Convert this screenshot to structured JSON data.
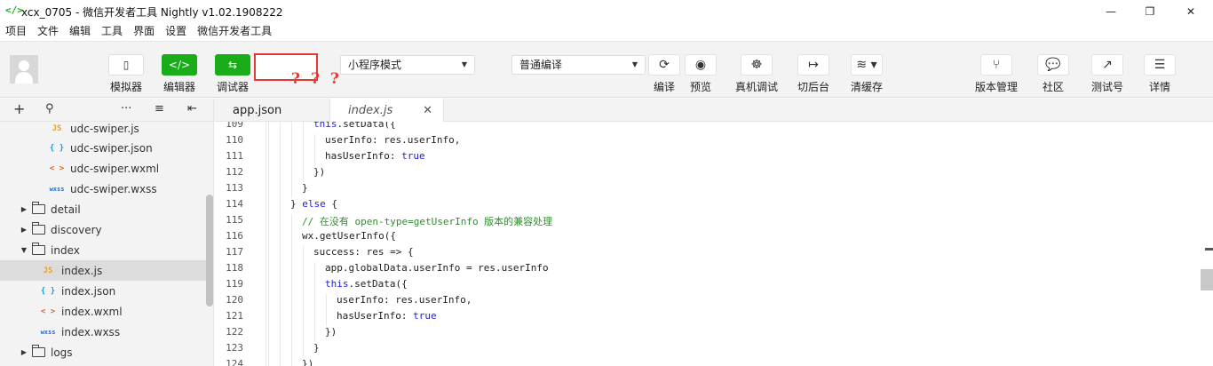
{
  "window": {
    "icon": "</>",
    "title": "xcx_0705 - 微信开发者工具 Nightly v1.02.1908222",
    "controls": [
      "—",
      "❐",
      "✕"
    ]
  },
  "menu": [
    "项目",
    "文件",
    "编辑",
    "工具",
    "界面",
    "设置",
    "微信开发者工具"
  ],
  "toolbar": {
    "left_buttons": [
      {
        "label": "模拟器",
        "icon": "phone-icon",
        "glyph": "▯"
      },
      {
        "label": "编辑器",
        "icon": "code-icon",
        "glyph": "</>"
      },
      {
        "label": "调试器",
        "icon": "debug-icon",
        "glyph": "⇆"
      }
    ],
    "annotation_marks": "???",
    "mode_select": "小程序模式",
    "compile_select": "普通编译",
    "center_buttons": [
      {
        "label": "编译",
        "icon": "refresh-icon",
        "glyph": "⟳"
      },
      {
        "label": "预览",
        "icon": "eye-icon",
        "glyph": "◉"
      },
      {
        "label": "真机调试",
        "icon": "bug-icon",
        "glyph": "☸"
      },
      {
        "label": "切后台",
        "icon": "switch-background-icon",
        "glyph": "↦"
      },
      {
        "label": "清缓存",
        "icon": "layers-icon",
        "glyph": "≋ ▾"
      }
    ],
    "right_buttons": [
      {
        "label": "版本管理",
        "icon": "branch-icon",
        "glyph": "⑂"
      },
      {
        "label": "社区",
        "icon": "chat-icon",
        "glyph": "💬"
      },
      {
        "label": "测试号",
        "icon": "external-link-icon",
        "glyph": "↗"
      },
      {
        "label": "详情",
        "icon": "menu-icon",
        "glyph": "☰"
      }
    ]
  },
  "sidebar": {
    "tools": [
      "+",
      "⚲",
      "···",
      "≡",
      "⇤"
    ],
    "items": [
      {
        "type": "js",
        "badge": "JS",
        "label": "udc-swiper.js"
      },
      {
        "type": "json",
        "badge": "{ }",
        "label": "udc-swiper.json"
      },
      {
        "type": "wxml",
        "badge": "< >",
        "label": "udc-swiper.wxml"
      },
      {
        "type": "wxss",
        "badge": "wxss",
        "label": "udc-swiper.wxss"
      },
      {
        "type": "folder",
        "expanded": false,
        "label": "detail"
      },
      {
        "type": "folder",
        "expanded": false,
        "label": "discovery"
      },
      {
        "type": "folder",
        "expanded": true,
        "label": "index"
      },
      {
        "type": "js",
        "badge": "JS",
        "label": "index.js",
        "selected": true
      },
      {
        "type": "json",
        "badge": "{ }",
        "label": "index.json"
      },
      {
        "type": "wxml",
        "badge": "< >",
        "label": "index.wxml"
      },
      {
        "type": "wxss",
        "badge": "wxss",
        "label": "index.wxss"
      },
      {
        "type": "folder",
        "expanded": false,
        "label": "logs"
      }
    ]
  },
  "editor": {
    "tabs": [
      {
        "label": "app.json",
        "active": false
      },
      {
        "label": "index.js",
        "active": true,
        "close": "✕"
      }
    ],
    "lines": [
      {
        "n": "109",
        "indent": 2,
        "parts": [
          [
            "kw",
            "this"
          ],
          [
            "",
            ".setData({"
          ]
        ]
      },
      {
        "n": "110",
        "indent": 3,
        "parts": [
          [
            "",
            "userInfo: res.userInfo,"
          ]
        ]
      },
      {
        "n": "111",
        "indent": 3,
        "parts": [
          [
            "",
            "hasUserInfo: "
          ],
          [
            "kw",
            "true"
          ]
        ]
      },
      {
        "n": "112",
        "indent": 2,
        "parts": [
          [
            "",
            "})"
          ]
        ]
      },
      {
        "n": "113",
        "indent": 1,
        "parts": [
          [
            "",
            "}"
          ]
        ]
      },
      {
        "n": "114",
        "indent": 0,
        "parts": [
          [
            "",
            "} "
          ],
          [
            "kw",
            "else"
          ],
          [
            "",
            " {"
          ]
        ]
      },
      {
        "n": "115",
        "indent": 1,
        "parts": [
          [
            "cm",
            "// 在没有 open-type=getUserInfo 版本的兼容处理"
          ]
        ]
      },
      {
        "n": "116",
        "indent": 1,
        "parts": [
          [
            "",
            "wx.getUserInfo({"
          ]
        ]
      },
      {
        "n": "117",
        "indent": 2,
        "parts": [
          [
            "",
            "success: res => {"
          ]
        ]
      },
      {
        "n": "118",
        "indent": 3,
        "parts": [
          [
            "",
            "app.globalData.userInfo = res.userInfo"
          ]
        ]
      },
      {
        "n": "119",
        "indent": 3,
        "parts": [
          [
            "kw",
            "this"
          ],
          [
            "",
            ".setData({"
          ]
        ]
      },
      {
        "n": "120",
        "indent": 4,
        "parts": [
          [
            "",
            "userInfo: res.userInfo,"
          ]
        ]
      },
      {
        "n": "121",
        "indent": 4,
        "parts": [
          [
            "",
            "hasUserInfo: "
          ],
          [
            "kw",
            "true"
          ]
        ]
      },
      {
        "n": "122",
        "indent": 3,
        "parts": [
          [
            "",
            "})"
          ]
        ]
      },
      {
        "n": "123",
        "indent": 2,
        "parts": [
          [
            "",
            "}"
          ]
        ]
      },
      {
        "n": "124",
        "indent": 1,
        "parts": [
          [
            "",
            "})"
          ]
        ]
      }
    ]
  }
}
